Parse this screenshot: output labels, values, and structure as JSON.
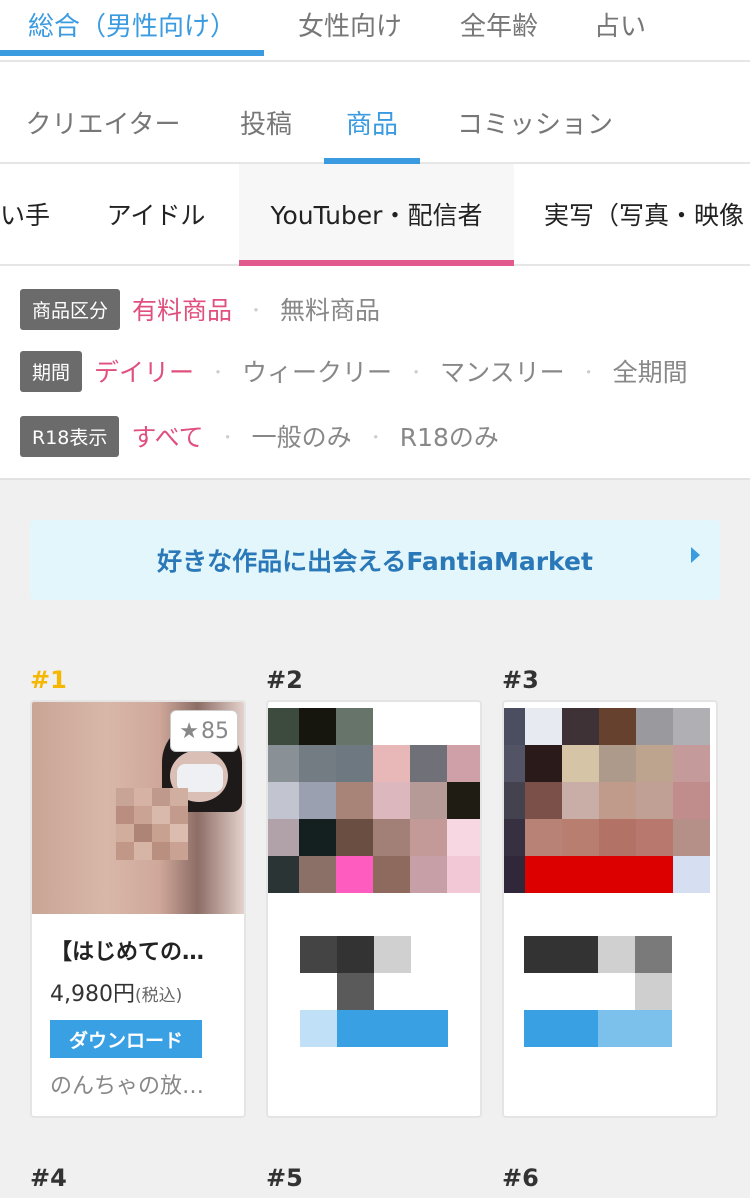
{
  "row1": {
    "tabs": [
      "総合（男性向け）",
      "女性向け",
      "全年齢",
      "占い"
    ]
  },
  "row2": {
    "tabs": [
      "クリエイター",
      "投稿",
      "商品",
      "コミッション"
    ]
  },
  "row3": {
    "tabs": [
      "い手",
      "アイドル",
      "YouTuber・配信者",
      "実写（写真・映像"
    ]
  },
  "filters": {
    "type": {
      "label": "商品区分",
      "options": [
        "有料商品",
        "無料商品"
      ]
    },
    "period": {
      "label": "期間",
      "options": [
        "デイリー",
        "ウィークリー",
        "マンスリー",
        "全期間"
      ]
    },
    "r18": {
      "label": "R18表示",
      "options": [
        "すべて",
        "一般のみ",
        "R18のみ"
      ]
    },
    "separator": "・"
  },
  "banner": {
    "text": "好きな作品に出会えるFantiaMarket"
  },
  "ranking": {
    "top": [
      "#1",
      "#2",
      "#3"
    ],
    "bottom": [
      "#4",
      "#5",
      "#6"
    ],
    "item1": {
      "favorites": "85",
      "title": "【はじめての…",
      "price": "4,980円",
      "tax": "(税込)",
      "badge": "ダウンロード",
      "shop": "のんちゃの放…"
    }
  },
  "colors": {
    "accent_blue": "#3a9be0",
    "accent_pink": "#e25a8d",
    "gold": "#f5b700"
  }
}
